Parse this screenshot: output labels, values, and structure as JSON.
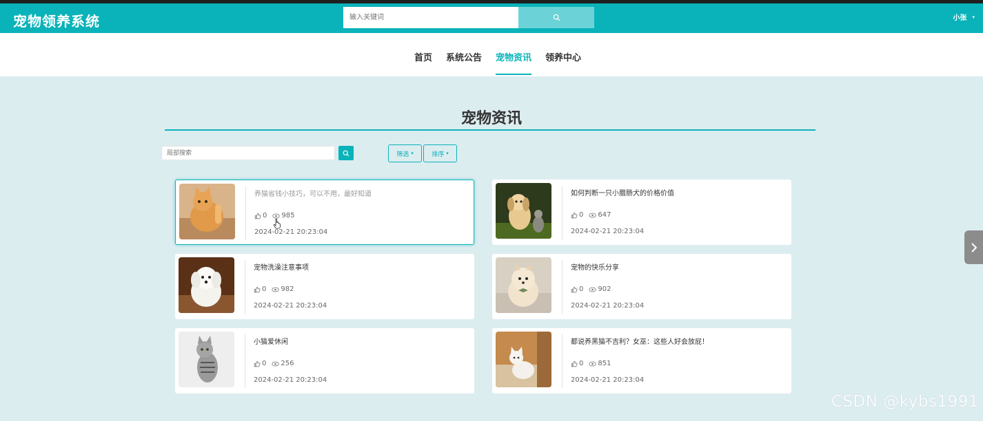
{
  "app": {
    "title": "宠物领养系统"
  },
  "header": {
    "search_placeholder": "输入关键词",
    "user_name": "小张",
    "user_caret": "▾"
  },
  "nav": {
    "items": [
      {
        "label": "首页"
      },
      {
        "label": "系统公告"
      },
      {
        "label": "宠物资讯",
        "active": true
      },
      {
        "label": "领养中心"
      }
    ]
  },
  "page": {
    "title": "宠物资讯",
    "local_search_placeholder": "局部搜索",
    "filter_label": "筛选",
    "sort_label": "排序",
    "caret": "▾"
  },
  "articles": [
    {
      "title": "养猫省钱小技巧，可以不用，最好知道",
      "likes": "0",
      "views": "985",
      "date": "2024-02-21 20:23:04",
      "image": "orange-cat-photo"
    },
    {
      "title": "如何判断一只小腊肠犬的价格价值",
      "likes": "0",
      "views": "647",
      "date": "2024-02-21 20:23:04",
      "image": "puppy-and-kitten-photo"
    },
    {
      "title": "宠物洗澡注意事项",
      "likes": "0",
      "views": "982",
      "date": "2024-02-21 20:23:04",
      "image": "white-maltese-photo"
    },
    {
      "title": "宠物的快乐分享",
      "likes": "0",
      "views": "902",
      "date": "2024-02-21 20:23:04",
      "image": "pomeranian-photo"
    },
    {
      "title": "小猫爱休闲",
      "likes": "0",
      "views": "256",
      "date": "2024-02-21 20:23:04",
      "image": "tabby-cat-photo"
    },
    {
      "title": "都说养黑猫不吉利？女巫：这些人好会放屁！",
      "likes": "0",
      "views": "851",
      "date": "2024-02-21 20:23:04",
      "image": "white-cat-on-step-photo"
    }
  ],
  "watermark": "CSDN @kybs1991",
  "colors": {
    "accent": "#09b3b9",
    "background": "#dcedf0",
    "search_button": "#6bd3d7"
  }
}
